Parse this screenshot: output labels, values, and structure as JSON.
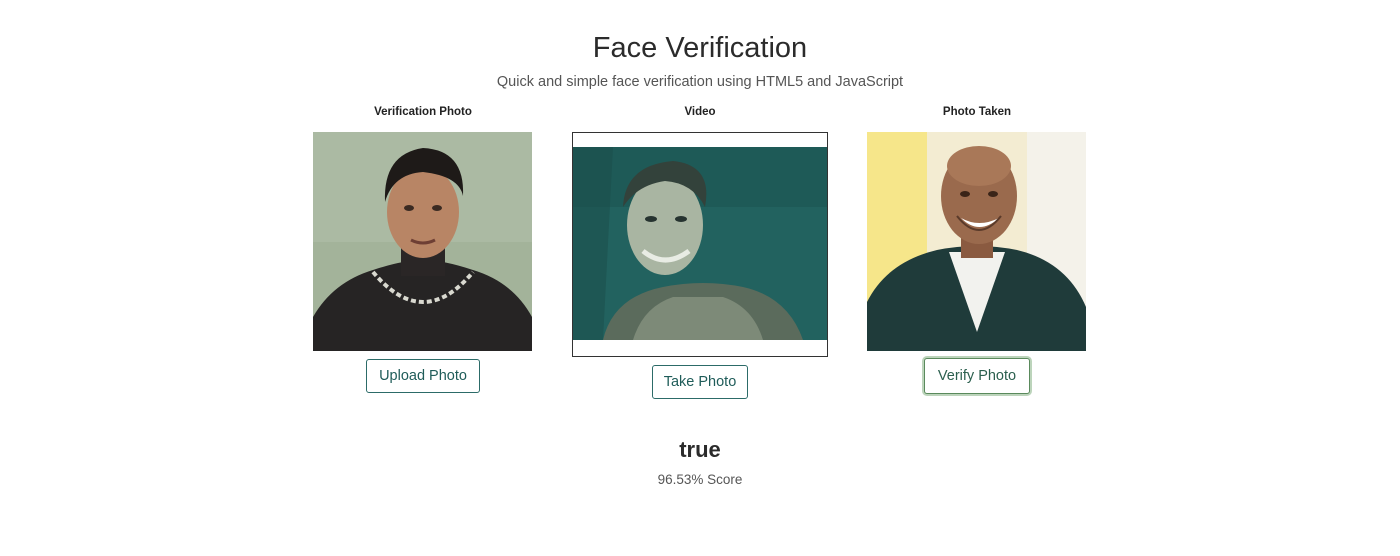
{
  "header": {
    "title": "Face Verification",
    "subtitle": "Quick and simple face verification using HTML5 and JavaScript"
  },
  "columns": [
    {
      "label": "Verification Photo",
      "button_label": "Upload Photo"
    },
    {
      "label": "Video",
      "button_label": "Take Photo"
    },
    {
      "label": "Photo Taken",
      "button_label": "Verify Photo"
    }
  ],
  "result": {
    "value": "true",
    "score_text": "96.53% Score"
  },
  "colors": {
    "button_text": "#1f5c59",
    "button_border": "#2c6b68",
    "video_background": "#22625f"
  }
}
